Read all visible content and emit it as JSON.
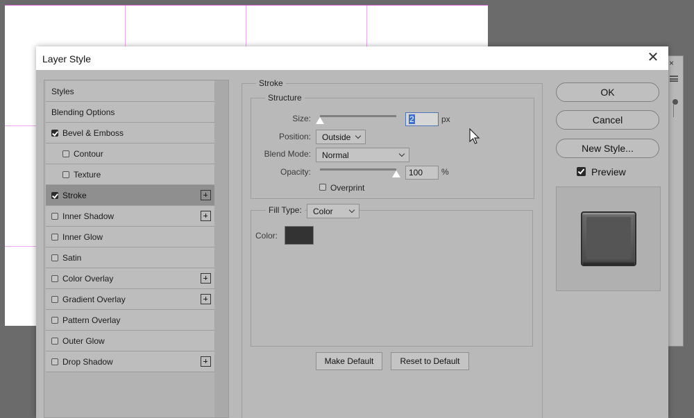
{
  "dialog": {
    "title": "Layer Style",
    "close_label": "✕"
  },
  "style_list": {
    "items": [
      {
        "label": "Styles",
        "checkbox": false,
        "checked": false,
        "indent": false,
        "plus": false,
        "selected": false
      },
      {
        "label": "Blending Options",
        "checkbox": false,
        "checked": false,
        "indent": false,
        "plus": false,
        "selected": false
      },
      {
        "label": "Bevel & Emboss",
        "checkbox": true,
        "checked": true,
        "indent": false,
        "plus": false,
        "selected": false
      },
      {
        "label": "Contour",
        "checkbox": true,
        "checked": false,
        "indent": true,
        "plus": false,
        "selected": false
      },
      {
        "label": "Texture",
        "checkbox": true,
        "checked": false,
        "indent": true,
        "plus": false,
        "selected": false
      },
      {
        "label": "Stroke",
        "checkbox": true,
        "checked": true,
        "indent": false,
        "plus": true,
        "selected": true
      },
      {
        "label": "Inner Shadow",
        "checkbox": true,
        "checked": false,
        "indent": false,
        "plus": true,
        "selected": false
      },
      {
        "label": "Inner Glow",
        "checkbox": true,
        "checked": false,
        "indent": false,
        "plus": false,
        "selected": false
      },
      {
        "label": "Satin",
        "checkbox": true,
        "checked": false,
        "indent": false,
        "plus": false,
        "selected": false
      },
      {
        "label": "Color Overlay",
        "checkbox": true,
        "checked": false,
        "indent": false,
        "plus": true,
        "selected": false
      },
      {
        "label": "Gradient Overlay",
        "checkbox": true,
        "checked": false,
        "indent": false,
        "plus": true,
        "selected": false
      },
      {
        "label": "Pattern Overlay",
        "checkbox": true,
        "checked": false,
        "indent": false,
        "plus": false,
        "selected": false
      },
      {
        "label": "Outer Glow",
        "checkbox": true,
        "checked": false,
        "indent": false,
        "plus": false,
        "selected": false
      },
      {
        "label": "Drop Shadow",
        "checkbox": true,
        "checked": false,
        "indent": false,
        "plus": true,
        "selected": false
      }
    ]
  },
  "stroke": {
    "group_title": "Stroke",
    "structure_title": "Structure",
    "size_label": "Size:",
    "size_value": "2",
    "size_unit": "px",
    "size_slider_fraction": 0.0,
    "position_label": "Position:",
    "position_value": "Outside",
    "blend_mode_label": "Blend Mode:",
    "blend_mode_value": "Normal",
    "opacity_label": "Opacity:",
    "opacity_value": "100",
    "opacity_unit": "%",
    "opacity_slider_fraction": 1.0,
    "overprint_label": "Overprint",
    "overprint_checked": false,
    "fill_type_label": "Fill Type:",
    "fill_type_value": "Color",
    "color_label": "Color:",
    "color_value": "#333333"
  },
  "buttons": {
    "make_default": "Make Default",
    "reset_to_default": "Reset to Default",
    "ok": "OK",
    "cancel": "Cancel",
    "new_style": "New Style..."
  },
  "preview": {
    "label": "Preview",
    "checked": true
  },
  "background_panel": {
    "close_label": "×"
  }
}
